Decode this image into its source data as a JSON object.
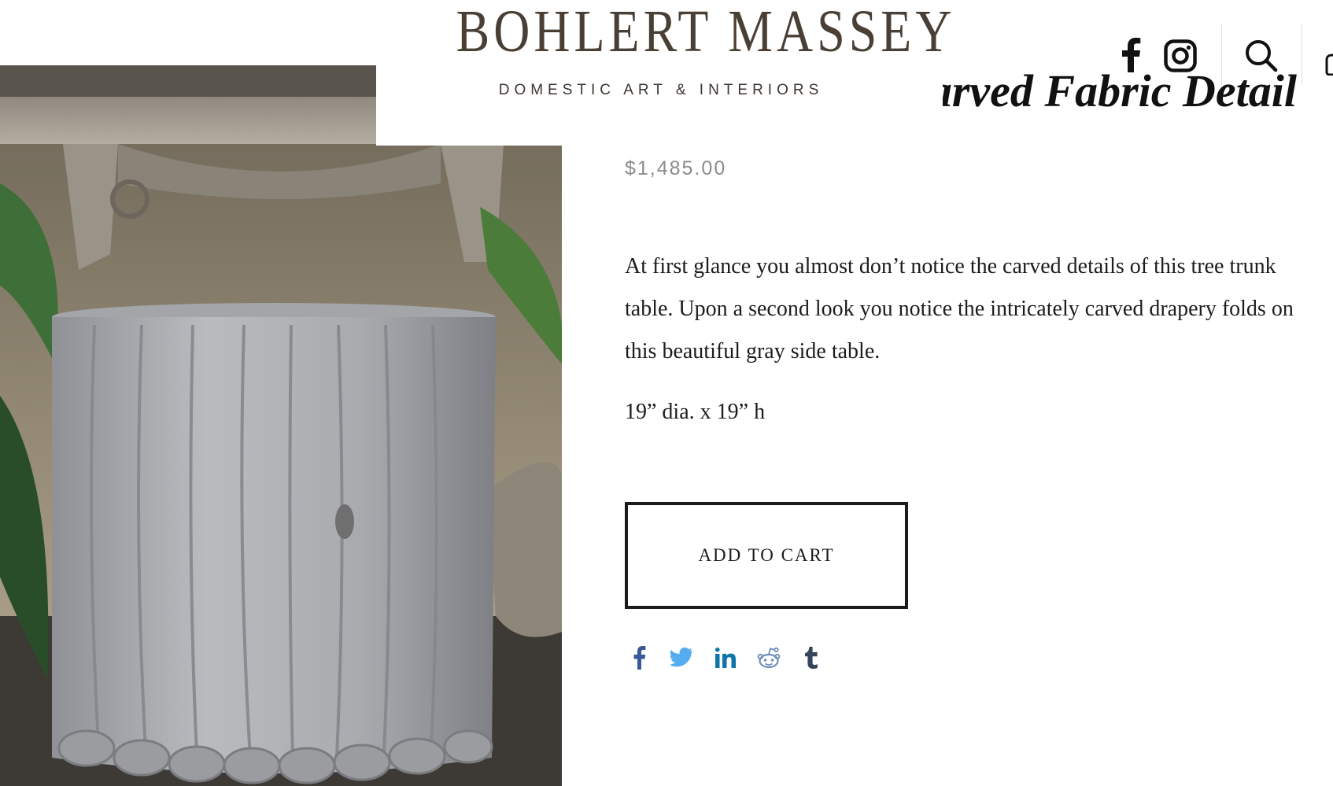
{
  "brand": {
    "name": "BOHLERT MASSEY",
    "tagline": "DOMESTIC ART & INTERIORS"
  },
  "header_icons": [
    "facebook-icon",
    "instagram-icon",
    "search-icon",
    "cart-icon"
  ],
  "product": {
    "title": "Carved Fabric Detail",
    "price": "$1,485.00",
    "description": "At first glance you almost don’t notice the carved details of this tree trunk table. Upon a second look you notice the intricately carved drapery folds on this beautiful gray side table.",
    "dimensions": "19” dia. x 19” h",
    "add_to_cart_label": "ADD TO CART",
    "image_alt": "Gray carved tree trunk side table with drapery folds"
  },
  "share_icons": [
    {
      "name": "facebook-share-icon",
      "color": "#3b5998"
    },
    {
      "name": "twitter-share-icon",
      "color": "#55acee"
    },
    {
      "name": "linkedin-share-icon",
      "color": "#0e76a8"
    },
    {
      "name": "reddit-share-icon",
      "color": "#6f8fb8"
    },
    {
      "name": "tumblr-share-icon",
      "color": "#35465c"
    }
  ],
  "colors": {
    "logo": "#4a3f34",
    "price": "#8c8c8c",
    "text": "#1c1c1c",
    "button_border": "#1c1c1c"
  }
}
